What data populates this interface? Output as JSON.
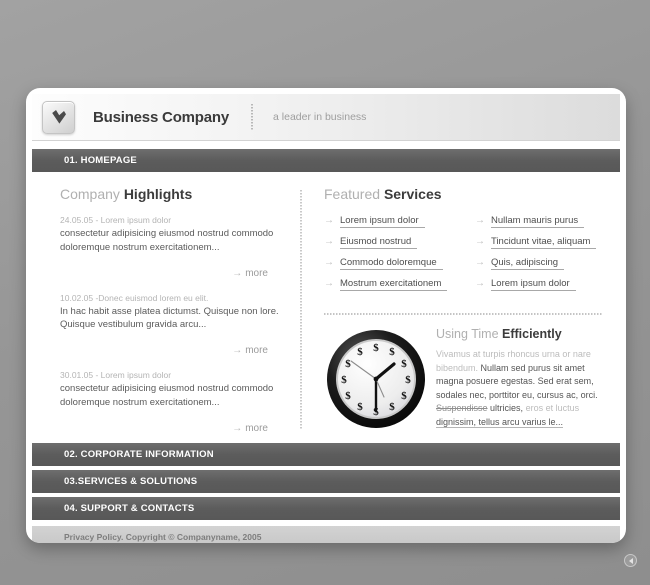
{
  "page": {
    "background_color": "#9a9a9a",
    "card_background": "#ffffff"
  },
  "header": {
    "logo_icon": "checkmark-badge-icon",
    "company_name": "Business Company",
    "tagline": "a leader in business",
    "separator": "dotted-vertical-divider"
  },
  "nav": {
    "active_bar": "01. HOMEPAGE",
    "bars": [
      {
        "label": "02. CORPORATE INFORMATION"
      },
      {
        "label": "03.SERVICES & SOLUTIONS"
      },
      {
        "label": "04. SUPPORT & CONTACTS"
      }
    ],
    "bar_color": "#5c5c5c"
  },
  "highlights": {
    "heading_light": "Company ",
    "heading_bold": "Highlights",
    "more_label": "more",
    "more_arrow": "→",
    "items": [
      {
        "date": "24.05.05 - Lorem ipsum dolor",
        "body": "consectetur adipisicing eiusmod nostrud commodo doloremque nostrum exercitationem..."
      },
      {
        "date": "10.02.05 -Donec euismod lorem eu elit.",
        "body": "In hac habit asse platea dictumst. Quisque non lore. Quisque vestibulum gravida arcu..."
      },
      {
        "date": "30.01.05 - Lorem ipsum dolor",
        "body": "consectetur adipisicing eiusmod nostrud commodo doloremque nostrum exercitationem..."
      }
    ]
  },
  "services": {
    "heading_light": "Featured ",
    "heading_bold": "Services",
    "arrow": "→",
    "column_left": [
      {
        "label": "Lorem ipsum dolor"
      },
      {
        "label": "Eiusmod nostrud"
      },
      {
        "label": "Commodo doloremque"
      },
      {
        "label": "Mostrum exercitationem"
      }
    ],
    "column_right": [
      {
        "label": "Nullam mauris purus"
      },
      {
        "label": "Tincidunt vitae, aliquam"
      },
      {
        "label": "Quis, adipiscing"
      },
      {
        "label": "Lorem ipsum dolor"
      }
    ]
  },
  "promo": {
    "heading_light": "Using Time ",
    "heading_bold": "Efficiently",
    "image_icon": "dollar-clock-icon",
    "clock_marker": "$",
    "body_part1": "Vivamus at turpis rhoncus urna or nare bibendum. ",
    "body_part2": "Nullam sed purus sit amet magna posuere egestas. Sed erat sem, sodales nec, porttitor eu, cursus ac, orci. ",
    "body_part3": "Suspendisse",
    "body_part4": " ultricies, ",
    "body_part5": "eros et luctus ",
    "body_part6": "dignissim, tellus arcu varius le..."
  },
  "footer": {
    "text": "Privacy Policy. Copyright © Companyname, 2005"
  },
  "back_button": {
    "icon": "back-arrow-icon"
  }
}
